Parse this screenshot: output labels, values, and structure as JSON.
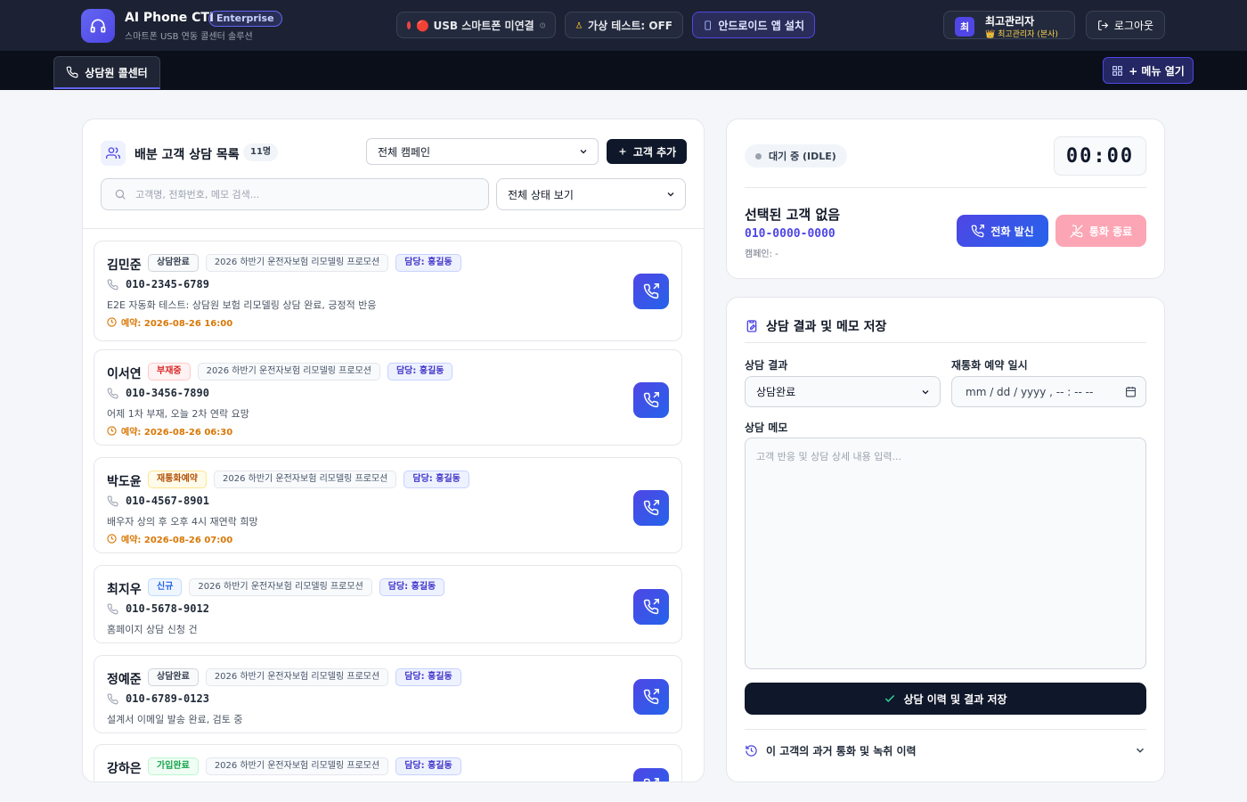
{
  "header": {
    "app_title": "AI Phone CTI",
    "edition": "Enterprise",
    "subtitle": "스마트폰 USB 연동 콜센터 솔루션",
    "usb_status": "🔴 USB 스마트폰 미연결",
    "virtual_test": "가상 테스트: OFF",
    "android_install": "안드로이드 앱 설치",
    "user": {
      "avatar": "최",
      "name": "최고관리자",
      "role": "👑 최고관리자 (본사)"
    },
    "logout": "로그아웃"
  },
  "nav": {
    "active_tab": "상담원 콜센터",
    "menu_button": "+ 메뉴 열기"
  },
  "customer_list": {
    "title": "배분 고객 상담 목록",
    "count": "11명",
    "campaign_filter": "전체 캠페인",
    "add_button": "고객 추가",
    "search_placeholder": "고객명, 전화번호, 메모 검색...",
    "status_filter": "전체 상태 보기",
    "customers": [
      {
        "name": "김민준",
        "status": "상담완료",
        "campaign": "2026 하반기 운전자보험 리모델링 프로모션",
        "owner": "담당: 홍길동",
        "phone": "010-2345-6789",
        "memo": "E2E 자동화 테스트: 상담원 보험 리모델링 상담 완료, 긍정적 반응",
        "reservation": "예약: 2026-08-26 16:00"
      },
      {
        "name": "이서연",
        "status": "부재중",
        "campaign": "2026 하반기 운전자보험 리모델링 프로모션",
        "owner": "담당: 홍길동",
        "phone": "010-3456-7890",
        "memo": "어제 1차 부재, 오늘 2차 연락 요망",
        "reservation": "예약: 2026-08-26 06:30"
      },
      {
        "name": "박도윤",
        "status": "재통화예약",
        "campaign": "2026 하반기 운전자보험 리모델링 프로모션",
        "owner": "담당: 홍길동",
        "phone": "010-4567-8901",
        "memo": "배우자 상의 후 오후 4시 재연락 희망",
        "reservation": "예약: 2026-08-26 07:00"
      },
      {
        "name": "최지우",
        "status": "신규",
        "campaign": "2026 하반기 운전자보험 리모델링 프로모션",
        "owner": "담당: 홍길동",
        "phone": "010-5678-9012",
        "memo": "홈페이지 상담 신청 건",
        "reservation": ""
      },
      {
        "name": "정예준",
        "status": "상담완료",
        "campaign": "2026 하반기 운전자보험 리모델링 프로모션",
        "owner": "담당: 홍길동",
        "phone": "010-6789-0123",
        "memo": "설계서 이메일 발송 완료, 검토 중",
        "reservation": ""
      },
      {
        "name": "강하은",
        "status": "가입완료",
        "campaign": "2026 하반기 운전자보험 리모델링 프로모션",
        "owner": "담당: 홍길동",
        "phone": "",
        "memo": "",
        "reservation": ""
      }
    ]
  },
  "call_panel": {
    "state": "대기 중 (IDLE)",
    "timer": "00:00",
    "selected_title": "선택된 고객 없음",
    "selected_phone": "010-0000-0000",
    "selected_campaign": "캠페인: -",
    "dial_button": "전화 발신",
    "end_button": "통화 종료"
  },
  "result_form": {
    "title": "상담 결과 및 메모 저장",
    "result_label": "상담 결과",
    "result_value": "상담완료",
    "callback_label": "재통화 예약 일시",
    "callback_placeholder": "mm / dd / yyyy , -- : --  --",
    "memo_label": "상담 메모",
    "memo_placeholder": "고객 반응 및 상담 상세 내용 입력...",
    "save_button": "상담 이력 및 결과 저장",
    "history_toggle": "이 고객의 과거 통화 및 녹취 이력"
  }
}
